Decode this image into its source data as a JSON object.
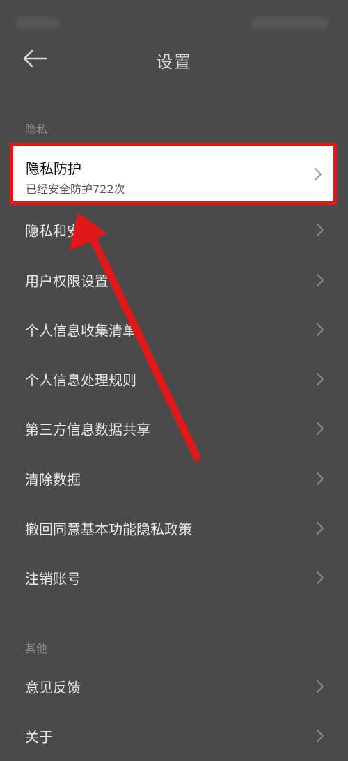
{
  "header": {
    "title": "设置"
  },
  "sections": {
    "privacy": {
      "label": "隐私",
      "highlighted": {
        "title": "隐私防护",
        "subtitle": "已经安全防护722次"
      },
      "items": [
        "隐私和安全",
        "用户权限设置",
        "个人信息收集清单",
        "个人信息处理规则",
        "第三方信息数据共享",
        "清除数据",
        "撤回同意基本功能隐私政策",
        "注销账号"
      ]
    },
    "other": {
      "label": "其他",
      "items": [
        "意见反馈",
        "关于"
      ]
    }
  },
  "icons": {
    "back": "back-arrow-icon",
    "chevron": "chevron-right-icon"
  },
  "colors": {
    "background": "#4a4a4a",
    "highlight_border": "#e11818",
    "arrow": "#e11818"
  }
}
